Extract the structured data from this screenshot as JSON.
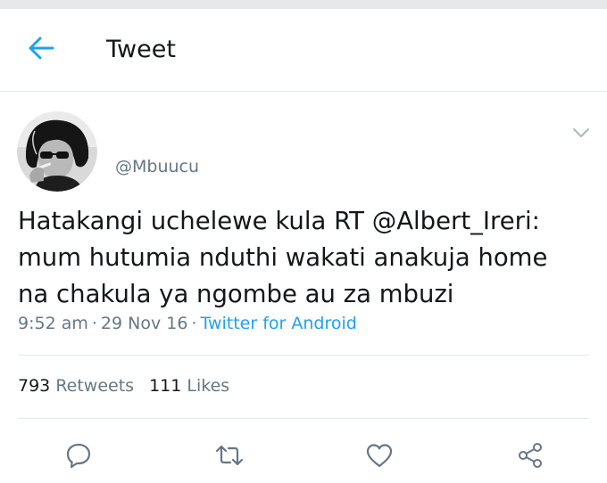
{
  "header": {
    "title": "Tweet"
  },
  "tweet": {
    "handle": "@Mbuucu",
    "text_line1": "Hatakangi uchelewe kula RT ",
    "text_mention": "@Albert_Ireri:",
    "text_line2": "mum hutumia nduthi wakati anakuja home",
    "text_line3": "na chakula ya ngombe au za mbuzi",
    "time": "9:52 am",
    "separator": "·",
    "date": "29 Nov 16",
    "source": "Twitter for Android"
  },
  "stats": {
    "retweets_count": "793",
    "retweets_label": "Retweets",
    "likes_count": "111",
    "likes_label": "Likes"
  },
  "icons": {
    "back": "arrow-left-icon",
    "caret": "chevron-down-icon",
    "reply": "reply-icon",
    "retweet": "retweet-icon",
    "like": "heart-icon",
    "share": "share-icon"
  },
  "colors": {
    "accent": "#1da1f2",
    "secondary_text": "#657786",
    "icon_gray": "#657786",
    "divider": "#e1e8ed"
  }
}
